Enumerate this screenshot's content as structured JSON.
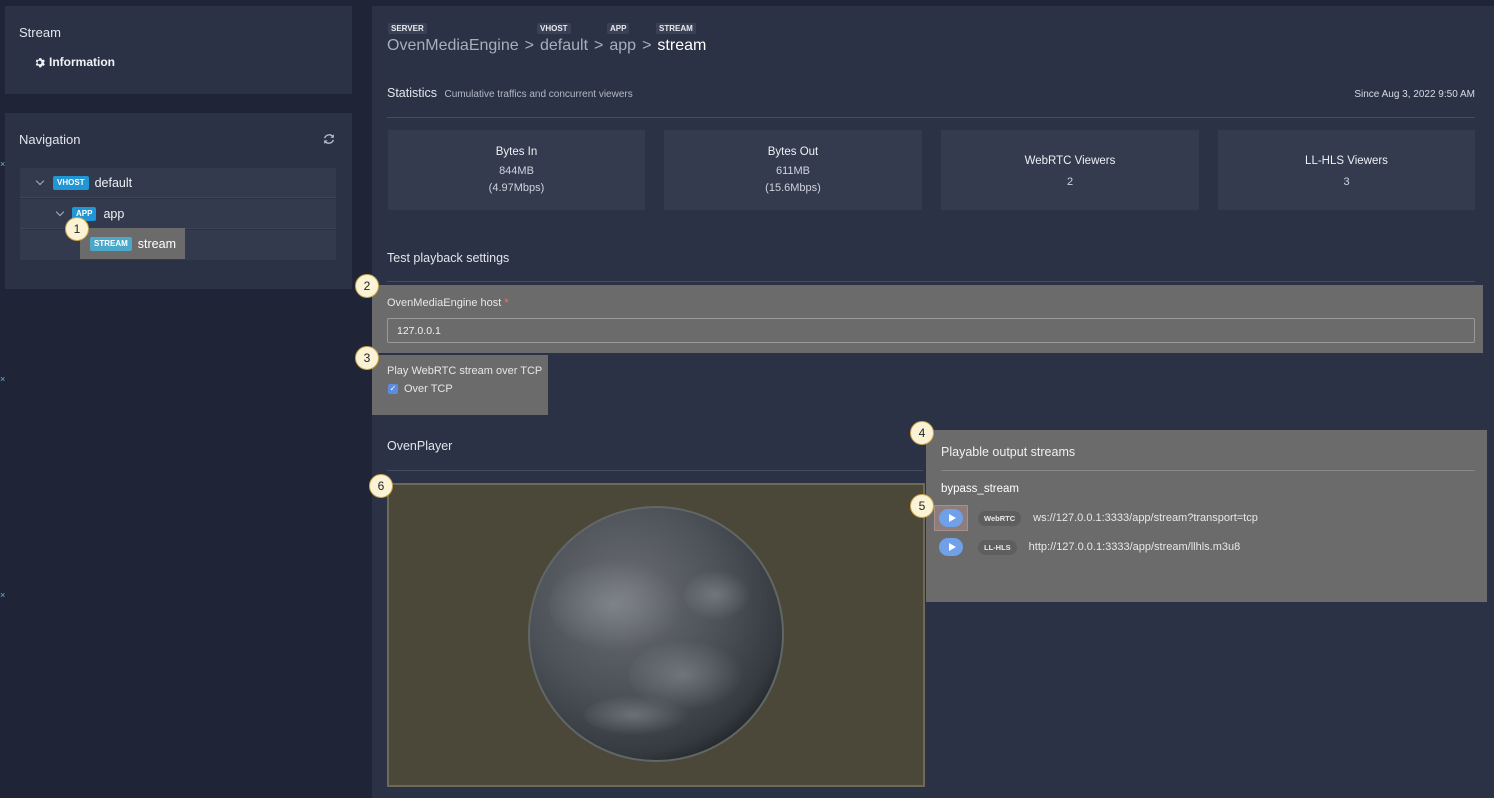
{
  "sidebar": {
    "stream_card": {
      "title": "Stream",
      "info_link": "Information"
    },
    "navigation": {
      "title": "Navigation",
      "tree": {
        "vhost": {
          "badge": "VHOST",
          "name": "default"
        },
        "app": {
          "badge": "APP",
          "name": "app"
        },
        "stream": {
          "badge": "STREAM",
          "name": "stream"
        }
      }
    }
  },
  "breadcrumb": {
    "labels": {
      "server": "SERVER",
      "vhost": "VHOST",
      "app": "APP",
      "stream": "STREAM"
    },
    "server": "OvenMediaEngine",
    "vhost": "default",
    "app": "app",
    "stream": "stream",
    "separator": ">"
  },
  "statistics": {
    "title": "Statistics",
    "subtitle": "Cumulative traffics and concurrent viewers",
    "since": "Since Aug 3, 2022 9:50 AM",
    "cards": [
      {
        "label": "Bytes In",
        "value": "844MB",
        "rate": "(4.97Mbps)"
      },
      {
        "label": "Bytes Out",
        "value": "611MB",
        "rate": "(15.6Mbps)"
      },
      {
        "label": "WebRTC Viewers",
        "value": "2"
      },
      {
        "label": "LL-HLS Viewers",
        "value": "3"
      }
    ]
  },
  "playback_settings": {
    "title": "Test playback settings",
    "host_label": "OvenMediaEngine host",
    "required_mark": "*",
    "host_value": "127.0.0.1",
    "tcp_label": "Play WebRTC stream over TCP",
    "tcp_checkbox_label": "Over TCP",
    "tcp_checked": true
  },
  "player": {
    "title": "OvenPlayer"
  },
  "outputs": {
    "title": "Playable output streams",
    "stream_name": "bypass_stream",
    "rows": [
      {
        "protocol": "WebRTC",
        "url": "ws://127.0.0.1:3333/app/stream?transport=tcp"
      },
      {
        "protocol": "LL-HLS",
        "url": "http://127.0.0.1:3333/app/stream/llhls.m3u8"
      }
    ]
  },
  "markers": [
    "1",
    "2",
    "3",
    "4",
    "5",
    "6"
  ],
  "colors": {
    "background": "#1f2536",
    "panel": "#2b3245",
    "accent": "#2196d4",
    "highlight": "#6b6b6b"
  }
}
